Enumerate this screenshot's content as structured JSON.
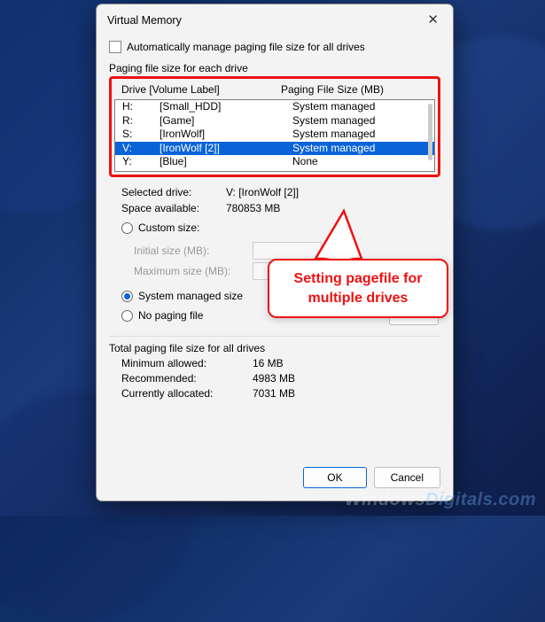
{
  "dialog": {
    "title": "Virtual Memory",
    "auto_manage_label": "Automatically manage paging file size for all drives",
    "section_label": "Paging file size for each drive",
    "col_drive": "Drive [Volume Label]",
    "col_pfs": "Paging File Size (MB)",
    "drives": [
      {
        "letter": "H:",
        "label": "[Small_HDD]",
        "pfs": "System managed",
        "selected": false
      },
      {
        "letter": "R:",
        "label": "[Game]",
        "pfs": "System managed",
        "selected": false
      },
      {
        "letter": "S:",
        "label": "[IronWolf]",
        "pfs": "System managed",
        "selected": false
      },
      {
        "letter": "V:",
        "label": "[IronWolf [2]]",
        "pfs": "System managed",
        "selected": true
      },
      {
        "letter": "Y:",
        "label": "[Blue]",
        "pfs": "None",
        "selected": false
      }
    ],
    "selected_drive_label": "Selected drive:",
    "selected_drive_value": "V:  [IronWolf [2]]",
    "space_label": "Space available:",
    "space_value": "780853 MB",
    "custom_size_label": "Custom size:",
    "initial_size_label": "Initial size (MB):",
    "maximum_size_label": "Maximum size (MB):",
    "system_managed_label": "System managed size",
    "no_paging_label": "No paging file",
    "set_button": "Set",
    "totals_header": "Total paging file size for all drives",
    "min_label": "Minimum allowed:",
    "min_value": "16 MB",
    "rec_label": "Recommended:",
    "rec_value": "4983 MB",
    "cur_label": "Currently allocated:",
    "cur_value": "7031 MB",
    "ok": "OK",
    "cancel": "Cancel"
  },
  "callout": {
    "text": "Setting pagefile for multiple drives"
  },
  "watermark": {
    "prefix": "Windows",
    "suffix": "Digitals.com"
  }
}
